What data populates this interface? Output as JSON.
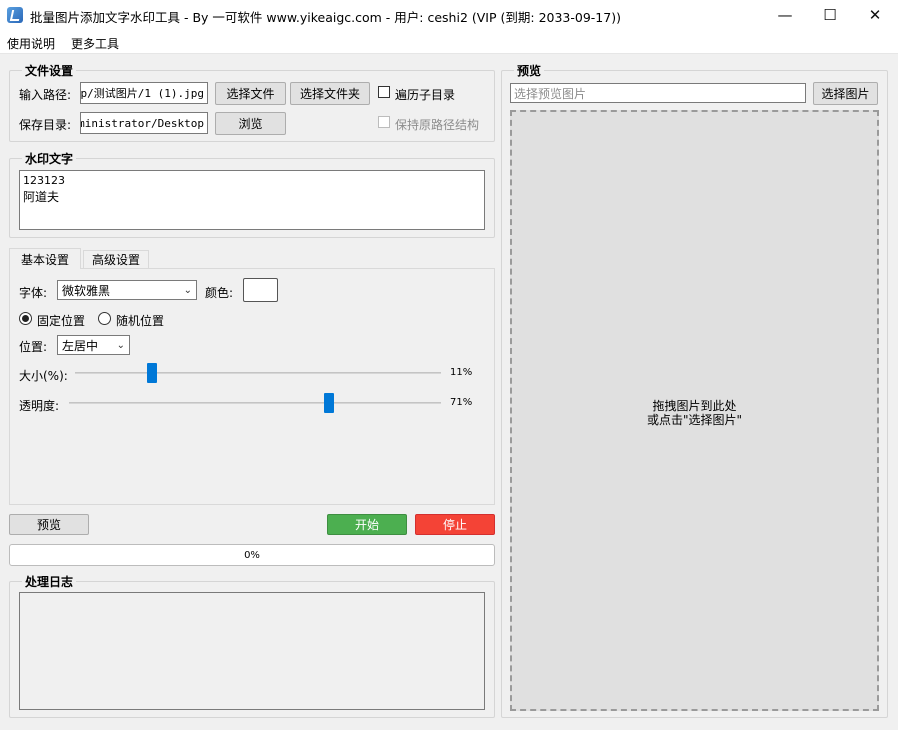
{
  "window": {
    "title": "批量图片添加文字水印工具 - By 一可软件 www.yikeaigc.com - 用户: ceshi2 (VIP (到期: 2033-09-17))",
    "minimize": "—",
    "maximize": "☐",
    "close": "✕"
  },
  "menu": [
    "使用说明",
    "更多工具"
  ],
  "file_settings": {
    "title": "文件设置",
    "input_label": "输入路径:",
    "input_value": "p/测试图片/1 (1).jpg",
    "select_file": "选择文件",
    "select_folder": "选择文件夹",
    "traverse_subdirs": "遍历子目录",
    "save_label": "保存目录:",
    "save_value": "dministrator/Desktop",
    "browse": "浏览",
    "keep_structure": "保持原路径结构"
  },
  "watermark": {
    "title": "水印文字",
    "line1": "123123",
    "line2": "阿道夫"
  },
  "tabs": [
    "基本设置",
    "高级设置"
  ],
  "basic": {
    "font_label": "字体:",
    "font_value": "微软雅黑",
    "color_label": "颜色:",
    "color_value": "#ffffff",
    "fixed_position": "固定位置",
    "random_position": "随机位置",
    "position_label": "位置:",
    "position_value": "左居中",
    "size_label": "大小(%):",
    "size_value": "11%",
    "size_fraction": 0.21,
    "opacity_label": "透明度:",
    "opacity_value": "71%",
    "opacity_fraction": 0.7
  },
  "actions": {
    "preview": "预览",
    "start": "开始",
    "stop": "停止",
    "start_color": "#4caf50",
    "stop_color": "#f44336"
  },
  "progress": {
    "text": "0%",
    "value": 0
  },
  "log": {
    "title": "处理日志"
  },
  "preview_panel": {
    "title": "预览",
    "placeholder": "选择预览图片",
    "select_image": "选择图片",
    "drop_line1": "拖拽图片到此处",
    "drop_line2": "或点击\"选择图片\""
  }
}
